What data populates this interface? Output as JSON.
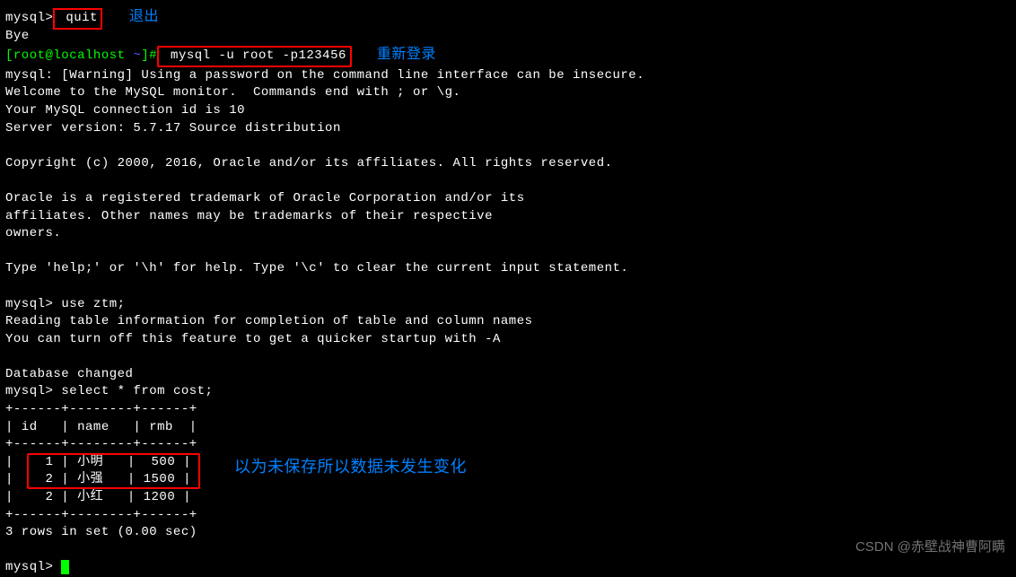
{
  "prompts": {
    "mysql": "mysql>",
    "root_user": "[root@localhost ",
    "tilde": "~",
    "root_end": "]#"
  },
  "commands": {
    "quit": " quit",
    "login": " mysql -u root -p123456",
    "use_db": " use ztm;",
    "select": " select * from cost;"
  },
  "annotations": {
    "quit": "退出",
    "login": "重新登录",
    "data": "以为未保存所以数据未发生变化"
  },
  "output": {
    "bye": "Bye",
    "warn": "mysql: [Warning] Using a password on the command line interface can be insecure.",
    "welcome": "Welcome to the MySQL monitor.  Commands end with ; or \\g.",
    "conn_id": "Your MySQL connection id is 10",
    "version": "Server version: 5.7.17 Source distribution",
    "copyright": "Copyright (c) 2000, 2016, Oracle and/or its affiliates. All rights reserved.",
    "oracle1": "Oracle is a registered trademark of Oracle Corporation and/or its",
    "oracle2": "affiliates. Other names may be trademarks of their respective",
    "oracle3": "owners.",
    "help": "Type 'help;' or '\\h' for help. Type '\\c' to clear the current input statement.",
    "reading": "Reading table information for completion of table and column names",
    "turnoff": "You can turn off this feature to get a quicker startup with -A",
    "dbchanged": "Database changed",
    "timing": "3 rows in set (0.00 sec)"
  },
  "table": {
    "sep": "+------+--------+------+",
    "header": "| id   | name   | rmb  |",
    "r1": "|    1 | 小明   |  500 |",
    "r2": "|    2 | 小强   | 1500 |",
    "r3": "|    2 | 小红   | 1200 |"
  },
  "watermark": "CSDN @赤壁战神曹阿瞒"
}
